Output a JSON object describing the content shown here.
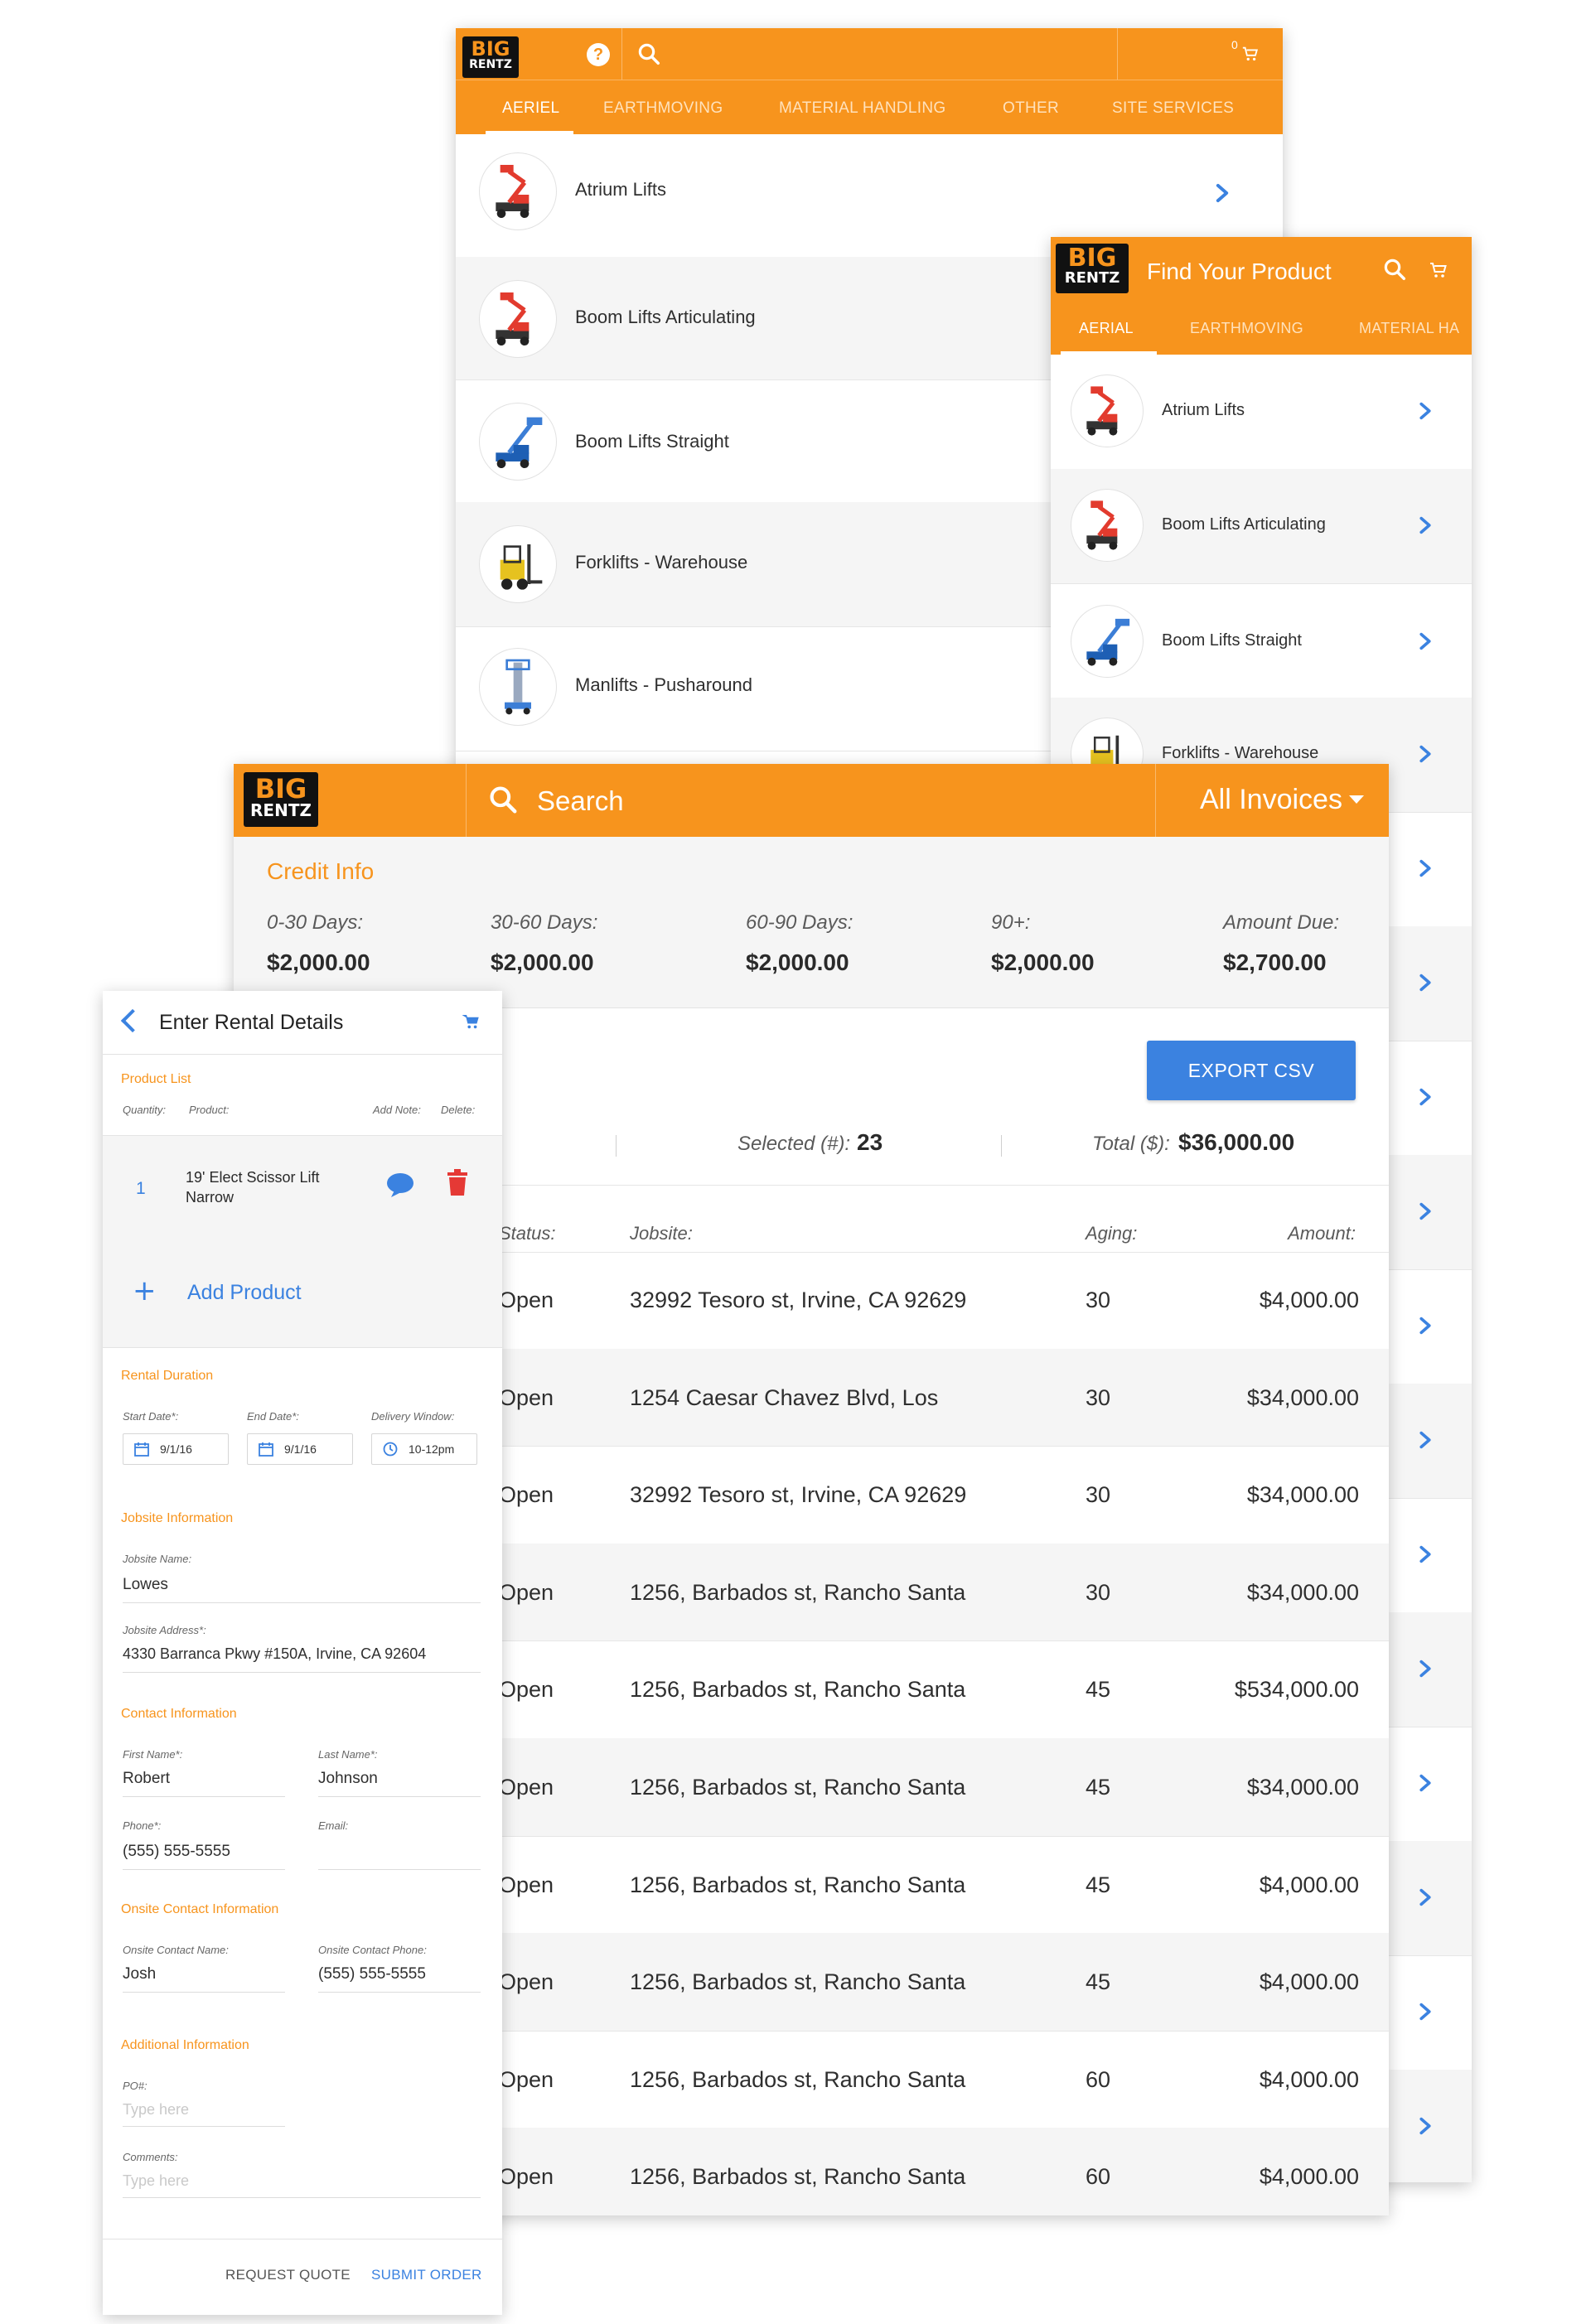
{
  "brand": {
    "logo_top": "BIG",
    "logo_bottom": "RENTZ",
    "orange": "#f7941d",
    "blue": "#3b82e0",
    "red": "#e53935"
  },
  "catalog": {
    "cart_count": "0",
    "tabs": [
      {
        "label": "AERIEL",
        "active": true
      },
      {
        "label": "EARTHMOVING",
        "active": false
      },
      {
        "label": "MATERIAL HANDLING",
        "active": false
      },
      {
        "label": "OTHER",
        "active": false
      },
      {
        "label": "SITE SERVICES",
        "active": false
      }
    ],
    "items": [
      {
        "label": "Atrium Lifts"
      },
      {
        "label": "Boom Lifts Articulating"
      },
      {
        "label": "Boom Lifts Straight"
      },
      {
        "label": "Forklifts - Warehouse"
      },
      {
        "label": "Manlifts - Pusharound"
      }
    ]
  },
  "finder": {
    "title": "Find Your Product",
    "tabs": [
      {
        "label": "AERIAL",
        "active": true
      },
      {
        "label": "EARTHMOVING",
        "active": false
      },
      {
        "label": "MATERIAL HA",
        "active": false
      }
    ],
    "items": [
      {
        "label": "Atrium Lifts"
      },
      {
        "label": "Boom Lifts Articulating"
      },
      {
        "label": "Boom Lifts Straight"
      },
      {
        "label": "Forklifts - Warehouse"
      }
    ]
  },
  "invoices": {
    "search_label": "Search",
    "filter_label": "All Invoices",
    "credit_title": "Credit Info",
    "credit": [
      {
        "label": "0-30 Days:",
        "value": "$2,000.00"
      },
      {
        "label": "30-60 Days:",
        "value": "$2,000.00"
      },
      {
        "label": "60-90 Days:",
        "value": "$2,000.00"
      },
      {
        "label": "90+:",
        "value": "$2,000.00"
      },
      {
        "label": "Amount Due:",
        "value": "$2,700.00"
      }
    ],
    "export_label": "EXPORT CSV",
    "selected_label": "Selected (#):",
    "selected_value": "23",
    "total_label": "Total ($):",
    "total_value": "$36,000.00",
    "columns": {
      "status": "Status:",
      "jobsite": "Jobsite:",
      "aging": "Aging:",
      "amount": "Amount:"
    },
    "rows": [
      {
        "status": "Open",
        "jobsite": "32992 Tesoro st, Irvine, CA 92629",
        "aging": "30",
        "amount": "$4,000.00"
      },
      {
        "status": "Open",
        "jobsite": "1254 Caesar Chavez Blvd, Los",
        "aging": "30",
        "amount": "$34,000.00"
      },
      {
        "status": "Open",
        "jobsite": "32992 Tesoro st, Irvine, CA 92629",
        "aging": "30",
        "amount": "$34,000.00"
      },
      {
        "status": "Open",
        "jobsite": "1256, Barbados st, Rancho Santa",
        "aging": "30",
        "amount": "$34,000.00"
      },
      {
        "status": "Open",
        "jobsite": "1256, Barbados st, Rancho Santa",
        "aging": "45",
        "amount": "$534,000.00"
      },
      {
        "status": "Open",
        "jobsite": "1256, Barbados st, Rancho Santa",
        "aging": "45",
        "amount": "$34,000.00"
      },
      {
        "status": "Open",
        "jobsite": "1256, Barbados st, Rancho Santa",
        "aging": "45",
        "amount": "$4,000.00"
      },
      {
        "status": "Open",
        "jobsite": "1256, Barbados st, Rancho Santa",
        "aging": "45",
        "amount": "$4,000.00"
      },
      {
        "status": "Open",
        "jobsite": "1256, Barbados st, Rancho Santa",
        "aging": "60",
        "amount": "$4,000.00"
      },
      {
        "status": "Open",
        "jobsite": "1256, Barbados st, Rancho Santa",
        "aging": "60",
        "amount": "$4,000.00"
      }
    ]
  },
  "rental": {
    "title": "Enter Rental Details",
    "product_list_title": "Product List",
    "col_quantity": "Quantity:",
    "col_product": "Product:",
    "col_add_note": "Add Note:",
    "col_delete": "Delete:",
    "product": {
      "quantity": "1",
      "name_line1": "19' Elect Scissor Lift",
      "name_line2": "Narrow"
    },
    "add_product_label": "Add Product",
    "duration_title": "Rental Duration",
    "start_label": "Start Date*:",
    "start_value": "9/1/16",
    "end_label": "End Date*:",
    "end_value": "9/1/16",
    "window_label": "Delivery Window:",
    "window_value": "10-12pm",
    "jobsite_title": "Jobsite Information",
    "jobsite_name_label": "Jobsite Name:",
    "jobsite_name_value": "Lowes",
    "jobsite_address_label": "Jobsite Address*:",
    "jobsite_address_value": "4330 Barranca Pkwy #150A, Irvine, CA 92604",
    "contact_title": "Contact Information",
    "first_name_label": "First Name*:",
    "first_name_value": "Robert",
    "last_name_label": "Last Name*:",
    "last_name_value": "Johnson",
    "phone_label": "Phone*:",
    "phone_value": "(555) 555-5555",
    "email_label": "Email:",
    "onsite_title": "Onsite Contact Information",
    "onsite_name_label": "Onsite Contact Name:",
    "onsite_name_value": "Josh",
    "onsite_phone_label": "Onsite Contact Phone:",
    "onsite_phone_value": "(555) 555-5555",
    "additional_title": "Additional Information",
    "po_label": "PO#:",
    "po_placeholder": "Type here",
    "comments_label": "Comments:",
    "comments_placeholder": "Type here",
    "request_quote_label": "REQUEST QUOTE",
    "submit_order_label": "SUBMIT ORDER"
  }
}
